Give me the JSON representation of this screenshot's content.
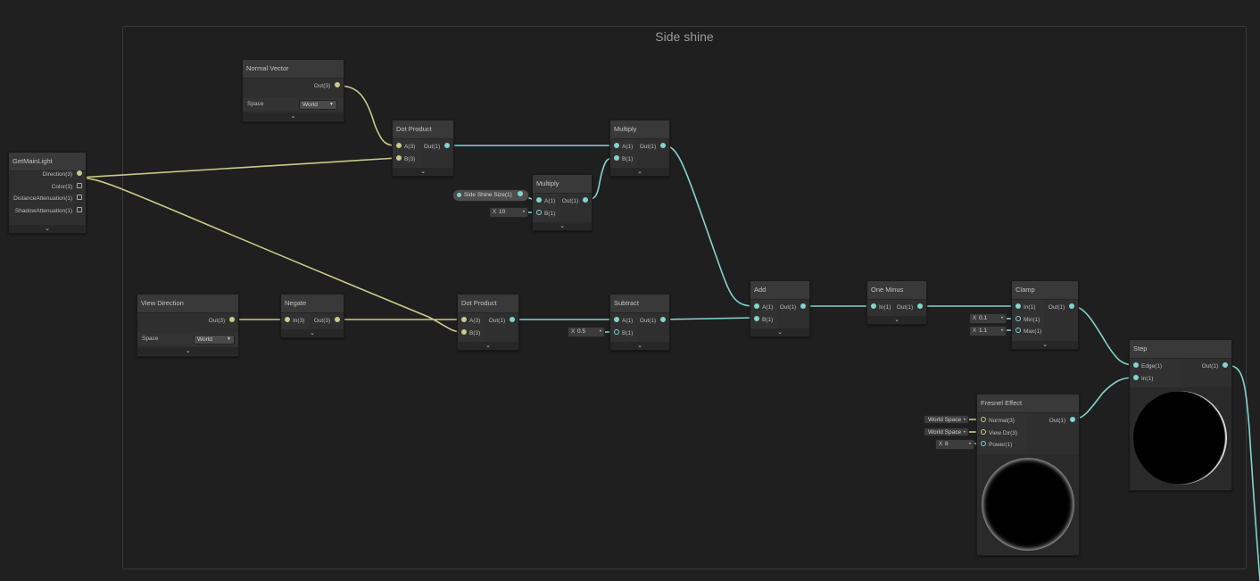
{
  "group": {
    "title": "Side shine"
  },
  "colors": {
    "vec3_wire": "#c8cc88",
    "float_wire": "#84d4ce",
    "background": "#202020"
  },
  "nodes": {
    "get_main_light": {
      "title": "GetMainLight",
      "outputs": [
        "Direction(3)",
        "Color(3)",
        "DistanceAttenuation(1)",
        "ShadowAttenuation(1)"
      ]
    },
    "normal_vector": {
      "title": "Normal Vector",
      "output": "Out(3)",
      "space_label": "Space",
      "space_value": "World"
    },
    "view_direction": {
      "title": "View Direction",
      "output": "Out(3)",
      "space_label": "Space",
      "space_value": "World"
    },
    "negate": {
      "title": "Negate",
      "input": "In(3)",
      "output": "Out(3)"
    },
    "dot_product_1": {
      "title": "Dot Product",
      "inputs": [
        "A(3)",
        "B(3)"
      ],
      "output": "Out(1)"
    },
    "dot_product_2": {
      "title": "Dot Product",
      "inputs": [
        "A(3)",
        "B(3)"
      ],
      "output": "Out(1)"
    },
    "side_shine_size": {
      "label": "Side Shine Size(1)"
    },
    "multiply_1": {
      "title": "Multiply",
      "inputs": [
        "A(1)",
        "B(1)"
      ],
      "output": "Out(1)",
      "b_axis": "X",
      "b_value": "10"
    },
    "multiply_2": {
      "title": "Multiply",
      "inputs": [
        "A(1)",
        "B(1)"
      ],
      "output": "Out(1)"
    },
    "subtract": {
      "title": "Subtract",
      "inputs": [
        "A(1)",
        "B(1)"
      ],
      "output": "Out(1)",
      "b_axis": "X",
      "b_value": "0.5"
    },
    "add": {
      "title": "Add",
      "inputs": [
        "A(1)",
        "B(1)"
      ],
      "output": "Out(1)"
    },
    "one_minus": {
      "title": "One Minus",
      "input": "In(1)",
      "output": "Out(1)"
    },
    "clamp": {
      "title": "Clamp",
      "inputs": [
        "In(1)",
        "Min(1)",
        "Max(1)"
      ],
      "output": "Out(1)",
      "min_axis": "X",
      "min_value": "0.1",
      "max_axis": "X",
      "max_value": "1.1"
    },
    "step": {
      "title": "Step",
      "inputs": [
        "Edge(1)",
        "In(1)"
      ],
      "output": "Out(1)"
    },
    "fresnel": {
      "title": "Fresnel Effect",
      "inputs": [
        "Normal(3)",
        "View Dir(3)",
        "Power(1)"
      ],
      "output": "Out(1)",
      "normal_field": "World Space",
      "view_field": "World Space",
      "power_axis": "X",
      "power_value": "8"
    }
  },
  "icons": {
    "collapse": "chevron-down-icon"
  }
}
